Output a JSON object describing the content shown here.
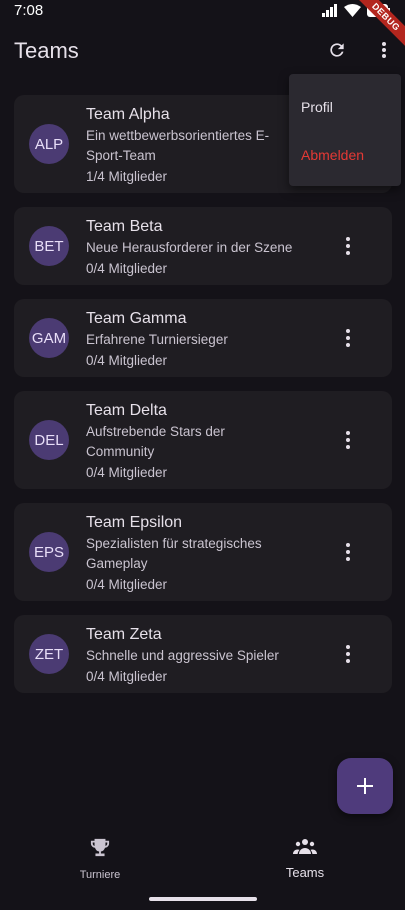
{
  "status": {
    "time": "7:08"
  },
  "debug_label": "DEBUG",
  "appbar": {
    "title": "Teams"
  },
  "menu": {
    "profile": "Profil",
    "logout": "Abmelden"
  },
  "teams": [
    {
      "initials": "ALP",
      "name": "Team Alpha",
      "desc": "Ein wettbewerbsorientiertes E-Sport-Team",
      "members": "1/4 Mitglieder"
    },
    {
      "initials": "BET",
      "name": "Team Beta",
      "desc": "Neue Herausforderer in der Szene",
      "members": "0/4 Mitglieder"
    },
    {
      "initials": "GAM",
      "name": "Team Gamma",
      "desc": "Erfahrene Turniersieger",
      "members": "0/4 Mitglieder"
    },
    {
      "initials": "DEL",
      "name": "Team Delta",
      "desc": "Aufstrebende Stars der Community",
      "members": "0/4 Mitglieder"
    },
    {
      "initials": "EPS",
      "name": "Team Epsilon",
      "desc": "Spezialisten für strategisches Gameplay",
      "members": "0/4 Mitglieder"
    },
    {
      "initials": "ZET",
      "name": "Team Zeta",
      "desc": "Schnelle und aggressive Spieler",
      "members": "0/4 Mitglieder"
    }
  ],
  "nav": {
    "tournaments": "Turniere",
    "teams": "Teams"
  },
  "fab_icon": "plus-icon",
  "colors": {
    "accent": "#4f3b7c",
    "avatar": "#4b3b73",
    "logout": "#e53935",
    "card": "#1f1d22"
  }
}
